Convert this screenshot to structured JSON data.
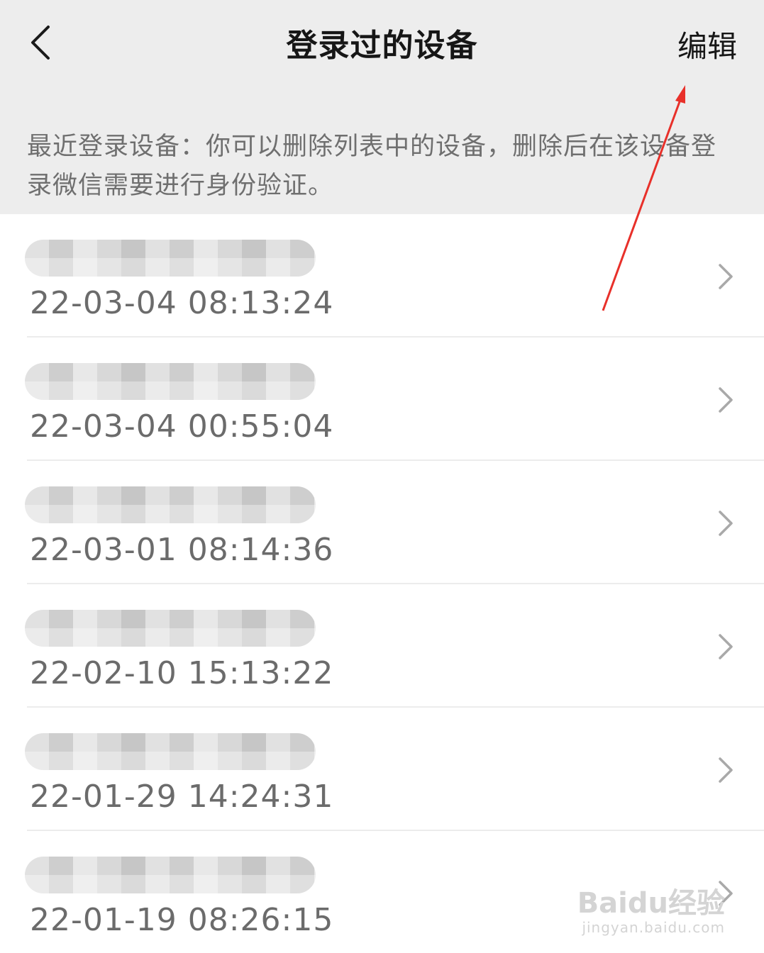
{
  "header": {
    "back_icon": "chevron-left-icon",
    "title": "登录过的设备",
    "edit_label": "编辑"
  },
  "description": "最近登录设备：你可以删除列表中的设备，删除后在该设备登录微信需要进行身份验证。",
  "devices": [
    {
      "name": "",
      "time": "22-03-04 08:13:24"
    },
    {
      "name": "",
      "time": "22-03-04 00:55:04"
    },
    {
      "name": "",
      "time": "22-03-01 08:14:36"
    },
    {
      "name": "",
      "time": "22-02-10 15:13:22"
    },
    {
      "name": "",
      "time": "22-01-29 14:24:31"
    },
    {
      "name": "",
      "time": "22-01-19 08:26:15"
    }
  ],
  "row_icon": "chevron-right-icon",
  "annotation": {
    "arrow_color": "#e8302a"
  },
  "watermark": {
    "brand": "Baidu经验",
    "url": "jingyan.baidu.com"
  },
  "colors": {
    "header_bg": "#ededed",
    "text_primary": "#161616",
    "text_secondary": "#6b6b6b"
  }
}
